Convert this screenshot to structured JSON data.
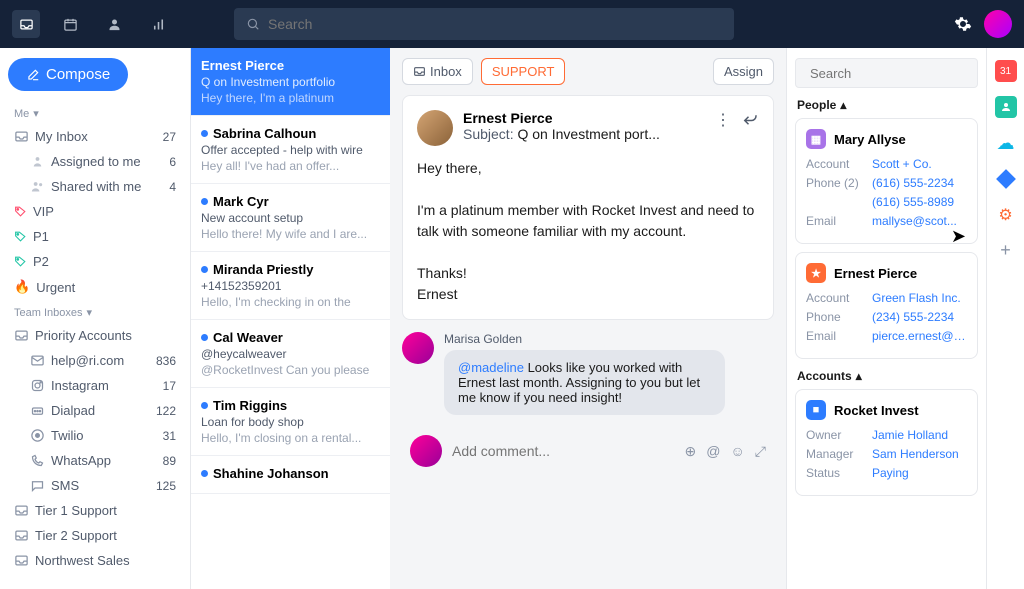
{
  "topbar": {
    "search_placeholder": "Search"
  },
  "sidebar": {
    "compose": "Compose",
    "section_me": "Me",
    "my_inbox": {
      "label": "My Inbox",
      "count": "27"
    },
    "assigned": {
      "label": "Assigned to me",
      "count": "6"
    },
    "shared": {
      "label": "Shared with me",
      "count": "4"
    },
    "tags": [
      {
        "label": "VIP",
        "color": "#ff4d6d"
      },
      {
        "label": "P1",
        "color": "#22c5a6"
      },
      {
        "label": "P2",
        "color": "#22c5a6"
      }
    ],
    "urgent": "Urgent",
    "section_team": "Team Inboxes",
    "team": [
      {
        "label": "Priority Accounts",
        "count": ""
      },
      {
        "label": "help@ri.com",
        "count": "836"
      },
      {
        "label": "Instagram",
        "count": "17"
      },
      {
        "label": "Dialpad",
        "count": "122"
      },
      {
        "label": "Twilio",
        "count": "31"
      },
      {
        "label": "WhatsApp",
        "count": "89"
      },
      {
        "label": "SMS",
        "count": "125"
      }
    ],
    "other": [
      "Tier 1 Support",
      "Tier 2 Support",
      "Northwest Sales"
    ]
  },
  "threads": [
    {
      "from": "Ernest Pierce",
      "subject": "Q on Investment portfolio",
      "preview": "Hey there, I'm a platinum",
      "selected": true
    },
    {
      "from": "Sabrina Calhoun",
      "subject": "Offer accepted - help with wire",
      "preview": "Hey all! I've had an offer...",
      "selected": false
    },
    {
      "from": "Mark Cyr",
      "subject": "New account setup",
      "preview": "Hello there! My wife and I are...",
      "selected": false
    },
    {
      "from": "Miranda Priestly",
      "subject": "+14152359201",
      "preview": "Hello, I'm checking in on the",
      "selected": false
    },
    {
      "from": "Cal Weaver",
      "subject": "@heycalweaver",
      "preview": "@RocketInvest Can you please",
      "selected": false
    },
    {
      "from": "Tim Riggins",
      "subject": "Loan for body shop",
      "preview": "Hello, I'm closing on a rental...",
      "selected": false
    },
    {
      "from": "Shahine Johanson",
      "subject": "",
      "preview": "",
      "selected": false
    }
  ],
  "conversation": {
    "inbox_pill": "Inbox",
    "support_pill": "SUPPORT",
    "assign_btn": "Assign",
    "message": {
      "from": "Ernest Pierce",
      "subject_label": "Subject:",
      "subject": "Q on Investment port...",
      "body": "Hey there,\n\nI'm a platinum member with Rocket Invest and need to talk with someone familiar with my account.\n\nThanks!\nErnest"
    },
    "note": {
      "author": "Marisa Golden",
      "mention": "@madeline",
      "text": " Looks like you worked with Ernest last month. Assigning to you but let me know if you need insight!"
    },
    "comment_placeholder": "Add comment..."
  },
  "context": {
    "search_placeholder": "Search",
    "people_label": "People",
    "people": [
      {
        "name": "Mary Allyse",
        "badge": "purple",
        "rows": [
          {
            "k": "Account",
            "v": "Scott + Co."
          },
          {
            "k": "Phone (2)",
            "v": "(616) 555-2234"
          },
          {
            "k": "",
            "v": "(616) 555-8989"
          },
          {
            "k": "Email",
            "v": "mallyse@scot..."
          }
        ]
      },
      {
        "name": "Ernest Pierce",
        "badge": "orange",
        "rows": [
          {
            "k": "Account",
            "v": "Green Flash Inc."
          },
          {
            "k": "Phone",
            "v": "(234) 555-2234"
          },
          {
            "k": "Email",
            "v": "pierce.ernest@gr..."
          }
        ]
      }
    ],
    "accounts_label": "Accounts",
    "accounts": [
      {
        "name": "Rocket Invest",
        "badge": "blue",
        "rows": [
          {
            "k": "Owner",
            "v": "Jamie Holland"
          },
          {
            "k": "Manager",
            "v": "Sam Henderson"
          },
          {
            "k": "Status",
            "v": "Paying"
          }
        ]
      }
    ]
  }
}
